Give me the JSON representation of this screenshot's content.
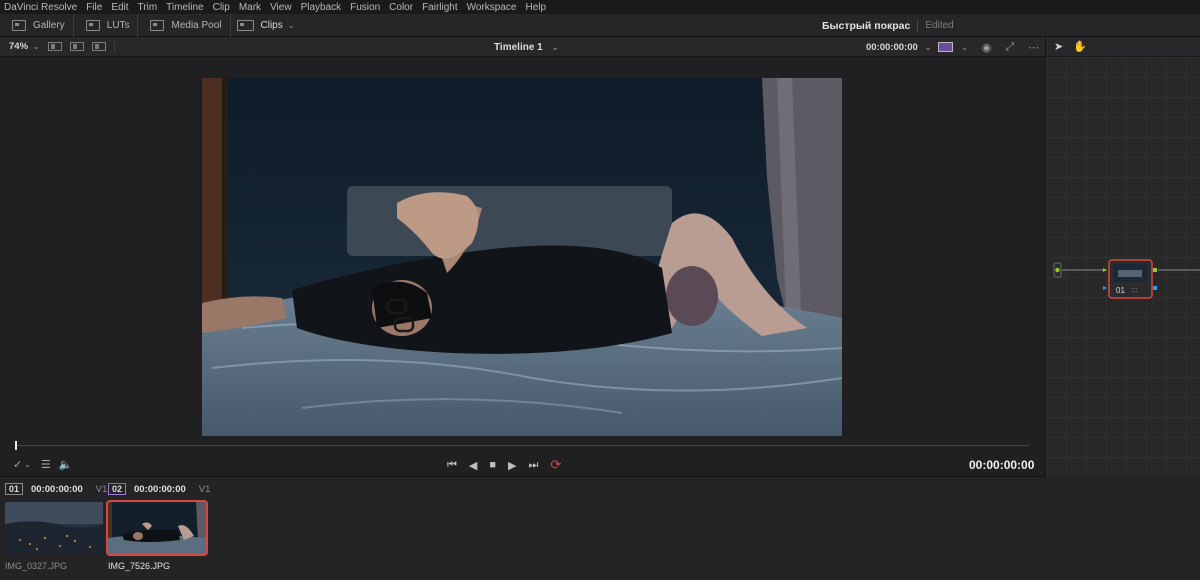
{
  "menu": [
    "DaVinci Resolve",
    "File",
    "Edit",
    "Trim",
    "Timeline",
    "Clip",
    "Mark",
    "View",
    "Playback",
    "Fusion",
    "Color",
    "Fairlight",
    "Workspace",
    "Help"
  ],
  "toolbar": {
    "gallery": "Gallery",
    "luts": "LUTs",
    "media_pool": "Media Pool",
    "clips": "Clips"
  },
  "project": {
    "name": "Быстрый покрас",
    "status": "Edited"
  },
  "viewer": {
    "zoom": "74%",
    "timeline_name": "Timeline 1",
    "timecode": "00:00:00:00"
  },
  "transport": {
    "timecode": "00:00:00:00"
  },
  "clips": [
    {
      "number": "01",
      "timecode": "00:00:00:00",
      "track": "V1",
      "name": "IMG_0327.JPG"
    },
    {
      "number": "02",
      "timecode": "00:00:00:00",
      "track": "V1",
      "name": "IMG_7526.JPG"
    }
  ],
  "node": {
    "label": "01"
  },
  "colors": {
    "accent_red": "#e0413a",
    "playhead": "#e8e8e8",
    "node_link": "#8ecb2a",
    "node_output": "#2a9cf0"
  }
}
